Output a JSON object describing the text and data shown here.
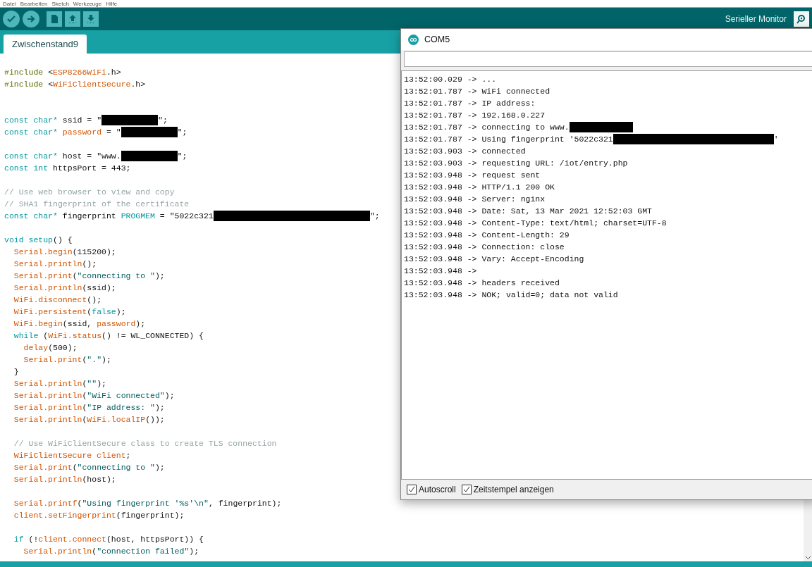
{
  "menu": [
    "Datei",
    "Bearbeiten",
    "Sketch",
    "Werkzeuge",
    "Hilfe"
  ],
  "toolbar": {
    "serial_monitor_label": "Serieller Monitor"
  },
  "tabs": [
    {
      "label": "Zwischenstand9",
      "selected": true
    }
  ],
  "code": [
    {
      "kind": "code",
      "segs": [
        {
          "kind": "pre",
          "text": "#include "
        },
        {
          "kind": "plain",
          "text": "<"
        },
        {
          "kind": "func",
          "text": "ESP8266WiFi"
        },
        {
          "kind": "plain",
          "text": ".h>"
        }
      ]
    },
    {
      "kind": "code",
      "segs": [
        {
          "kind": "pre",
          "text": "#include "
        },
        {
          "kind": "plain",
          "text": "<"
        },
        {
          "kind": "func",
          "text": "WiFiClientSecure"
        },
        {
          "kind": "plain",
          "text": ".h>"
        }
      ]
    },
    {
      "kind": "blank"
    },
    {
      "kind": "blank"
    },
    {
      "kind": "code",
      "segs": [
        {
          "kind": "keyword",
          "text": "const char*"
        },
        {
          "kind": "plain",
          "text": " ssid = \""
        },
        {
          "kind": "redacted_short"
        },
        {
          "kind": "plain",
          "text": "\";"
        }
      ]
    },
    {
      "kind": "code",
      "segs": [
        {
          "kind": "keyword",
          "text": "const char*"
        },
        {
          "kind": "func",
          "text": " password"
        },
        {
          "kind": "plain",
          "text": " = \""
        },
        {
          "kind": "redacted_short"
        },
        {
          "kind": "plain",
          "text": "\";"
        }
      ]
    },
    {
      "kind": "blank"
    },
    {
      "kind": "code",
      "segs": [
        {
          "kind": "keyword",
          "text": "const char*"
        },
        {
          "kind": "plain",
          "text": " host = \"www."
        },
        {
          "kind": "redacted_short"
        },
        {
          "kind": "plain",
          "text": "\";"
        }
      ]
    },
    {
      "kind": "code",
      "segs": [
        {
          "kind": "keyword",
          "text": "const int"
        },
        {
          "kind": "plain",
          "text": " httpsPort = 443;"
        }
      ]
    },
    {
      "kind": "blank"
    },
    {
      "kind": "code",
      "segs": [
        {
          "kind": "comment",
          "text": "// Use web browser to view and copy"
        }
      ]
    },
    {
      "kind": "code",
      "segs": [
        {
          "kind": "comment",
          "text": "// SHA1 fingerprint of the certificate"
        }
      ]
    },
    {
      "kind": "code",
      "segs": [
        {
          "kind": "keyword",
          "text": "const char*"
        },
        {
          "kind": "plain",
          "text": " fingerprint "
        },
        {
          "kind": "keyword",
          "text": "PROGMEM"
        },
        {
          "kind": "plain",
          "text": " = \"5022c321"
        },
        {
          "kind": "redacted_long"
        },
        {
          "kind": "plain",
          "text": "\";"
        }
      ]
    },
    {
      "kind": "blank"
    },
    {
      "kind": "code",
      "segs": [
        {
          "kind": "keyword",
          "text": "void setup"
        },
        {
          "kind": "plain",
          "text": "() {"
        }
      ]
    },
    {
      "kind": "code",
      "segs": [
        {
          "kind": "func",
          "text": "  Serial.begin"
        },
        {
          "kind": "plain",
          "text": "(115200);"
        }
      ]
    },
    {
      "kind": "code",
      "segs": [
        {
          "kind": "func",
          "text": "  Serial.println"
        },
        {
          "kind": "plain",
          "text": "();"
        }
      ]
    },
    {
      "kind": "code",
      "segs": [
        {
          "kind": "func",
          "text": "  Serial.print"
        },
        {
          "kind": "plain",
          "text": "("
        },
        {
          "kind": "string",
          "text": "\"connecting to \""
        },
        {
          "kind": "plain",
          "text": ");"
        }
      ]
    },
    {
      "kind": "code",
      "segs": [
        {
          "kind": "func",
          "text": "  Serial.println"
        },
        {
          "kind": "plain",
          "text": "(ssid);"
        }
      ]
    },
    {
      "kind": "code",
      "segs": [
        {
          "kind": "func",
          "text": "  WiFi.disconnect"
        },
        {
          "kind": "plain",
          "text": "();"
        }
      ]
    },
    {
      "kind": "code",
      "segs": [
        {
          "kind": "func",
          "text": "  WiFi.persistent"
        },
        {
          "kind": "plain",
          "text": "("
        },
        {
          "kind": "keyword",
          "text": "false"
        },
        {
          "kind": "plain",
          "text": ");"
        }
      ]
    },
    {
      "kind": "code",
      "segs": [
        {
          "kind": "func",
          "text": "  WiFi.begin"
        },
        {
          "kind": "plain",
          "text": "(ssid, "
        },
        {
          "kind": "func",
          "text": "password"
        },
        {
          "kind": "plain",
          "text": ");"
        }
      ]
    },
    {
      "kind": "code",
      "segs": [
        {
          "kind": "keyword",
          "text": "  while"
        },
        {
          "kind": "plain",
          "text": " ("
        },
        {
          "kind": "func",
          "text": "WiFi.status"
        },
        {
          "kind": "plain",
          "text": "() != WL_CONNECTED) {"
        }
      ]
    },
    {
      "kind": "code",
      "segs": [
        {
          "kind": "func",
          "text": "    delay"
        },
        {
          "kind": "plain",
          "text": "(500);"
        }
      ]
    },
    {
      "kind": "code",
      "segs": [
        {
          "kind": "func",
          "text": "    Serial.print"
        },
        {
          "kind": "plain",
          "text": "("
        },
        {
          "kind": "string",
          "text": "\".\""
        },
        {
          "kind": "plain",
          "text": ");"
        }
      ]
    },
    {
      "kind": "code",
      "segs": [
        {
          "kind": "plain",
          "text": "  }"
        }
      ]
    },
    {
      "kind": "code",
      "segs": [
        {
          "kind": "func",
          "text": "  Serial.println"
        },
        {
          "kind": "plain",
          "text": "("
        },
        {
          "kind": "string",
          "text": "\"\""
        },
        {
          "kind": "plain",
          "text": ");"
        }
      ]
    },
    {
      "kind": "code",
      "segs": [
        {
          "kind": "func",
          "text": "  Serial.println"
        },
        {
          "kind": "plain",
          "text": "("
        },
        {
          "kind": "string",
          "text": "\"WiFi connected\""
        },
        {
          "kind": "plain",
          "text": ");"
        }
      ]
    },
    {
      "kind": "code",
      "segs": [
        {
          "kind": "func",
          "text": "  Serial.println"
        },
        {
          "kind": "plain",
          "text": "("
        },
        {
          "kind": "string",
          "text": "\"IP address: \""
        },
        {
          "kind": "plain",
          "text": ");"
        }
      ]
    },
    {
      "kind": "code",
      "segs": [
        {
          "kind": "func",
          "text": "  Serial.println"
        },
        {
          "kind": "plain",
          "text": "("
        },
        {
          "kind": "func",
          "text": "WiFi.localIP"
        },
        {
          "kind": "plain",
          "text": "());"
        }
      ]
    },
    {
      "kind": "blank"
    },
    {
      "kind": "code",
      "segs": [
        {
          "kind": "comment",
          "text": "  // Use WiFiClientSecure class to create TLS connection"
        }
      ]
    },
    {
      "kind": "code",
      "segs": [
        {
          "kind": "func",
          "text": "  WiFiClientSecure client"
        },
        {
          "kind": "plain",
          "text": ";"
        }
      ]
    },
    {
      "kind": "code",
      "segs": [
        {
          "kind": "func",
          "text": "  Serial.print"
        },
        {
          "kind": "plain",
          "text": "("
        },
        {
          "kind": "string",
          "text": "\"connecting to \""
        },
        {
          "kind": "plain",
          "text": ");"
        }
      ]
    },
    {
      "kind": "code",
      "segs": [
        {
          "kind": "func",
          "text": "  Serial.println"
        },
        {
          "kind": "plain",
          "text": "(host);"
        }
      ]
    },
    {
      "kind": "blank"
    },
    {
      "kind": "code",
      "segs": [
        {
          "kind": "func",
          "text": "  Serial.printf"
        },
        {
          "kind": "plain",
          "text": "("
        },
        {
          "kind": "string",
          "text": "\"Using fingerprint '%s'\\n\""
        },
        {
          "kind": "plain",
          "text": ", fingerprint);"
        }
      ]
    },
    {
      "kind": "code",
      "segs": [
        {
          "kind": "func",
          "text": "  client.setFingerprint"
        },
        {
          "kind": "plain",
          "text": "(fingerprint);"
        }
      ]
    },
    {
      "kind": "blank"
    },
    {
      "kind": "code",
      "segs": [
        {
          "kind": "keyword",
          "text": "  if"
        },
        {
          "kind": "plain",
          "text": " (!"
        },
        {
          "kind": "func",
          "text": "client.connect"
        },
        {
          "kind": "plain",
          "text": "(host, httpsPort)) {"
        }
      ]
    },
    {
      "kind": "code",
      "segs": [
        {
          "kind": "func",
          "text": "    Serial.println"
        },
        {
          "kind": "plain",
          "text": "("
        },
        {
          "kind": "string",
          "text": "\"connection failed\""
        },
        {
          "kind": "plain",
          "text": ");"
        }
      ]
    }
  ],
  "serial_monitor": {
    "title": "COM5",
    "output": [
      [
        {
          "kind": "plain",
          "text": "13:52:00.029 -> ..."
        }
      ],
      [
        {
          "kind": "plain",
          "text": "13:52:01.787 -> WiFi connected"
        }
      ],
      [
        {
          "kind": "plain",
          "text": "13:52:01.787 -> IP address:"
        }
      ],
      [
        {
          "kind": "plain",
          "text": "13:52:01.787 -> 192.168.0.227"
        }
      ],
      [
        {
          "kind": "plain",
          "text": "13:52:01.787 -> connecting to www."
        },
        {
          "kind": "redacted_medium"
        }
      ],
      [
        {
          "kind": "plain",
          "text": "13:52:01.787 -> Using fingerprint '5022c321"
        },
        {
          "kind": "redacted_xlong"
        },
        {
          "kind": "plain",
          "text": "'"
        }
      ],
      [
        {
          "kind": "plain",
          "text": "13:52:03.903 -> connected"
        }
      ],
      [
        {
          "kind": "plain",
          "text": "13:52:03.903 -> requesting URL: /iot/entry.php"
        }
      ],
      [
        {
          "kind": "plain",
          "text": "13:52:03.948 -> request sent"
        }
      ],
      [
        {
          "kind": "plain",
          "text": "13:52:03.948 -> HTTP/1.1 200 OK"
        }
      ],
      [
        {
          "kind": "plain",
          "text": "13:52:03.948 -> Server: nginx"
        }
      ],
      [
        {
          "kind": "plain",
          "text": "13:52:03.948 -> Date: Sat, 13 Mar 2021 12:52:03 GMT"
        }
      ],
      [
        {
          "kind": "plain",
          "text": "13:52:03.948 -> Content-Type: text/html; charset=UTF-8"
        }
      ],
      [
        {
          "kind": "plain",
          "text": "13:52:03.948 -> Content-Length: 29"
        }
      ],
      [
        {
          "kind": "plain",
          "text": "13:52:03.948 -> Connection: close"
        }
      ],
      [
        {
          "kind": "plain",
          "text": "13:52:03.948 -> Vary: Accept-Encoding"
        }
      ],
      [
        {
          "kind": "plain",
          "text": "13:52:03.948 ->"
        }
      ],
      [
        {
          "kind": "plain",
          "text": "13:52:03.948 -> headers received"
        }
      ],
      [
        {
          "kind": "plain",
          "text": "13:52:03.948 -> NOK; valid=0; data not valid"
        }
      ]
    ],
    "options": [
      {
        "label": "Autoscroll",
        "checked": true
      },
      {
        "label": "Zeitstempel anzeigen",
        "checked": true
      }
    ]
  }
}
